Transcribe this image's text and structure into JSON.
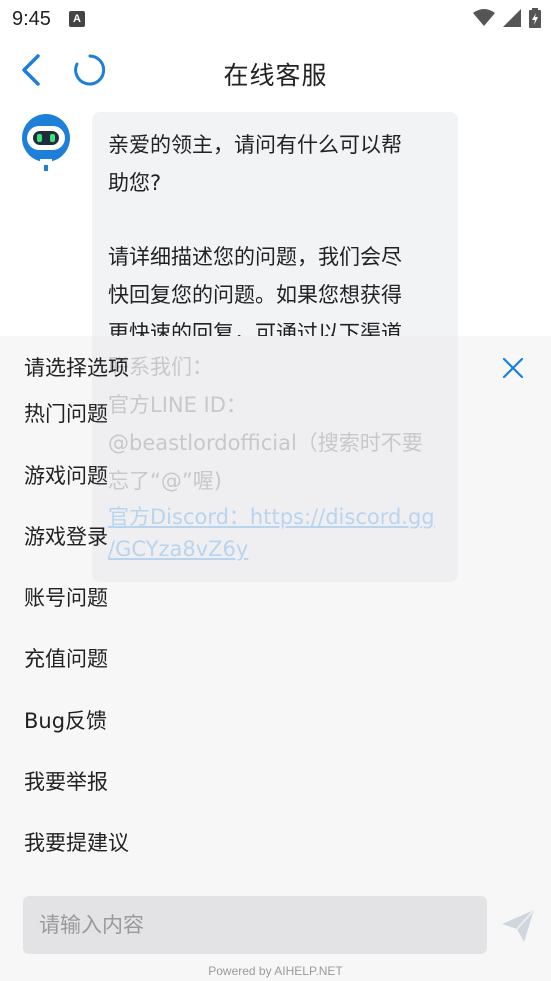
{
  "status_bar": {
    "time": "9:45",
    "notification_glyph": "A"
  },
  "header": {
    "title": "在线客服"
  },
  "message": {
    "line1": "亲爱的领主，请问有什么可以帮",
    "line2": "助您?",
    "line3": "请详细描述您的问题，我们会尽",
    "line4": "快回复您的问题。如果您想获得",
    "line5": "更快速的回复，可通过以下渠道",
    "line6": "联系我们：",
    "line7": "官方LINE ID：",
    "line8": "@beastlordofficial（搜索时不要",
    "line9": "忘了“@”喔)",
    "line10": "官方Discord：https://discord.gg",
    "line11": "/GCYza8vZ6y"
  },
  "options": {
    "title": "请选择选项",
    "items": [
      "热门问题",
      "游戏问题",
      "游戏登录",
      "账号问题",
      "充值问题",
      "Bug反馈",
      "我要举报",
      "我要提建议"
    ]
  },
  "input": {
    "placeholder": "请输入内容"
  },
  "footer": {
    "powered_by": "Powered by AIHELP.NET"
  },
  "colors": {
    "accent": "#1d7fd8",
    "panel_bg": "#f7f7f8",
    "bubble_bg": "#f2f3f5"
  }
}
